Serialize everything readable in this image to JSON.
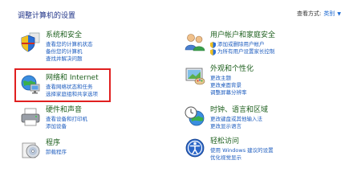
{
  "header": {
    "title": "调整计算机的设置",
    "view_by_label": "查看方式:",
    "view_by_value": "类别"
  },
  "categories": [
    {
      "title": "系统和安全",
      "links": [
        "查看您的计算机状态",
        "备份您的计算机",
        "查找并解决问题"
      ]
    },
    {
      "title": "网络和 Internet",
      "links": [
        "查看网络状态和任务",
        "选择家庭组和共享选项"
      ]
    },
    {
      "title": "硬件和声音",
      "links": [
        "查看设备和打印机",
        "添加设备"
      ]
    },
    {
      "title": "程序",
      "links": [
        "卸载程序"
      ]
    },
    {
      "title": "用户帐户和家庭安全",
      "links": [
        "添加或删除用户帐户",
        "为所有用户设置家长控制"
      ]
    },
    {
      "title": "外观和个性化",
      "links": [
        "更改主题",
        "更改桌面背景",
        "调整屏幕分辨率"
      ]
    },
    {
      "title": "时钟、语言和区域",
      "links": [
        "更改键盘或其他输入法",
        "更改显示语言"
      ]
    },
    {
      "title": "轻松访问",
      "links": [
        "使用 Windows 建议的设置",
        "优化视觉显示"
      ]
    }
  ],
  "colors": {
    "category_title": "#1d5f1d",
    "link": "#1e5dbf",
    "highlight": "#e02020"
  },
  "icons": {
    "system": "shield-icon",
    "network": "network-globe-icon",
    "hardware": "printer-icon",
    "programs": "programs-disc-icon",
    "users": "users-icon",
    "appearance": "paint-palette-icon",
    "clock": "clock-globe-icon",
    "ease": "ease-of-access-icon"
  }
}
